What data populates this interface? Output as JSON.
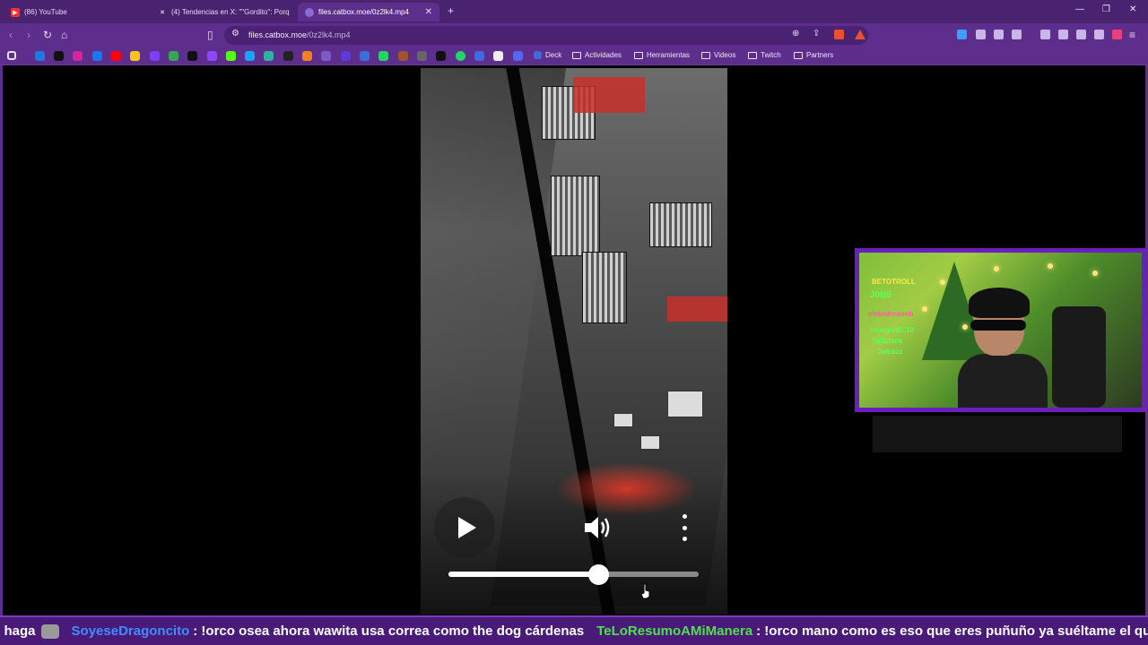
{
  "tabs": [
    {
      "title": "(86) YouTube",
      "favicon": "youtube-icon",
      "color": "#ff2d2d"
    },
    {
      "title": "(4) Tendencias en X: \"\"Gordito\": Porq",
      "favicon": "x-icon",
      "color": "#000000"
    },
    {
      "title": "files.catbox.moe/0z2lk4.mp4",
      "favicon": "catbox-icon",
      "color": "#8a6bd1",
      "active": true
    }
  ],
  "address": {
    "host": "files.catbox.moe",
    "path": "/0z2lk4.mp4"
  },
  "bookmarks": {
    "folders": [
      "Deck",
      "Actividades",
      "Herramientas",
      "Videos",
      "Twitch",
      "Partners"
    ]
  },
  "video": {
    "progress": 0.6
  },
  "webcam": {
    "overlay_lines": [
      "BETOTROLL",
      "J0B5",
      "elmodresonb",
      "Incognit0_10",
      "Yallblack",
      "Jemazz"
    ]
  },
  "chat": [
    {
      "user": "",
      "message": "e haga",
      "user_color": "#ffffff",
      "emote": true
    },
    {
      "user": "SoyeseDragoncito",
      "message": ": !orco osea ahora wawita usa correa como the dog cárdenas",
      "user_color": "#3d8fff"
    },
    {
      "user": "TeLoResumoAMiManera",
      "message": ": !orco mano como es eso que eres puñuño ya suéltame el queso",
      "user_color": "#4fe04f"
    }
  ],
  "colors": {
    "accent": "#5e2e8c",
    "tabbar": "#4a2370",
    "webcam_border": "#6a1fbe",
    "ticker_bg": "#4a1a78"
  }
}
